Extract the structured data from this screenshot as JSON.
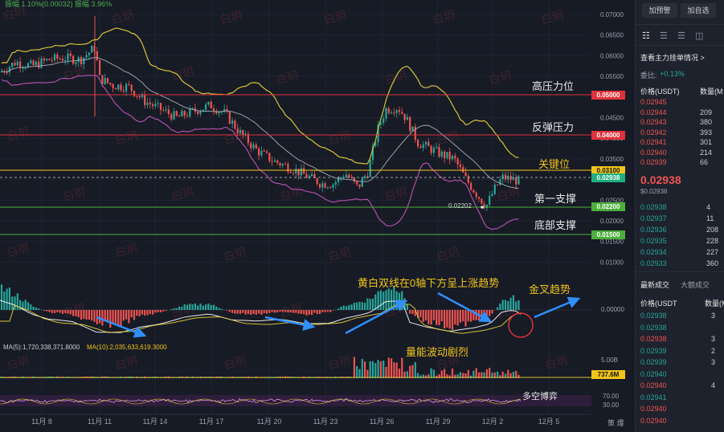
{
  "header": {
    "label": "振幅 1.10%(0.00032) 振幅 3.96%"
  },
  "watermark": "白玥",
  "price_axis": [
    "0.07000",
    "0.06500",
    "0.06000",
    "0.05500",
    "0.05000",
    "0.04500",
    "0.04000",
    "0.03500",
    "0.03000",
    "0.02500",
    "0.02000",
    "0.01500",
    "0.01000"
  ],
  "level_tags": [
    {
      "text": "0.05000",
      "color": "#e0323c"
    },
    {
      "text": "0.04000",
      "color": "#e0323c"
    },
    {
      "text": "0.03100",
      "color": "#f0c419"
    },
    {
      "text": "0.02938",
      "color": "#1fae7e"
    },
    {
      "text": "0.02200",
      "color": "#4caf3a"
    },
    {
      "text": "0.01500",
      "color": "#4caf3a"
    }
  ],
  "level_labels": {
    "high": "高压力位",
    "rebound": "反弹压力",
    "key": "关键位",
    "support1": "第一支撑",
    "support2": "底部支撑"
  },
  "low_marker": "0.02202",
  "macd": {
    "zero": "0.00000",
    "annotation1": "黄白双线在0轴下方呈上涨趋势",
    "annotation2": "金叉趋势"
  },
  "volume": {
    "ma5": "MA(5):1,720,338,371.8000",
    "ma10": "MA(10):2,035,633,619.3000",
    "axis_top": "5.00B",
    "last": "737.6M",
    "annotation": "量能波动剧烈"
  },
  "rsi": {
    "annotation": "多空博弈",
    "axis": [
      "70.00",
      "30.00"
    ]
  },
  "date_axis": [
    "11月 8",
    "11月 11",
    "11月 14",
    "11月 17",
    "11月 20",
    "11月 23",
    "11月 26",
    "11月 29",
    "12月 2",
    "12月 5"
  ],
  "corner_text": "策 爆",
  "colors": {
    "up": "#26a69a",
    "down": "#ef5350",
    "accent": "#f0c419",
    "bg": "#171b26"
  },
  "panel": {
    "buttons": [
      "加预警",
      "加自选"
    ],
    "toolbar_icons": [
      "layout-icon",
      "list-icon",
      "list-alt-icon",
      "split-icon"
    ],
    "link": "查看主力挂单情况 >",
    "change_label": "委比:",
    "change_value": "+0.13%",
    "col_price": "价格(USDT)",
    "col_qty": "数量(M",
    "asks": [
      {
        "p": "0.02945",
        "q": ""
      },
      {
        "p": "0.02944",
        "q": "209"
      },
      {
        "p": "0.02943",
        "q": "380"
      },
      {
        "p": "0.02942",
        "q": "393"
      },
      {
        "p": "0.02941",
        "q": "301"
      },
      {
        "p": "0.02940",
        "q": "214"
      },
      {
        "p": "0.02939",
        "q": "66"
      }
    ],
    "last_price": "0.02938",
    "last_sub": "$0.02938",
    "bids": [
      {
        "p": "0.02938",
        "q": "4"
      },
      {
        "p": "0.02937",
        "q": "11"
      },
      {
        "p": "0.02936",
        "q": "208"
      },
      {
        "p": "0.02935",
        "q": "228"
      },
      {
        "p": "0.02934",
        "q": "227"
      },
      {
        "p": "0.02933",
        "q": "360"
      }
    ],
    "trades_tab": "最新成交",
    "large_tab": "大额成交",
    "trade_col_price": "价格(USDT",
    "trade_col_qty": "数量(M",
    "trades": [
      {
        "p": "0.02938",
        "q": "3",
        "side": "buy"
      },
      {
        "p": "0.02938",
        "q": "",
        "side": "buy"
      },
      {
        "p": "0.02938",
        "q": "3",
        "side": "sell"
      },
      {
        "p": "0.02939",
        "q": "2",
        "side": "buy"
      },
      {
        "p": "0.02939",
        "q": "3",
        "side": "buy"
      },
      {
        "p": "0.02940",
        "q": "",
        "side": "buy"
      },
      {
        "p": "0.02940",
        "q": "4",
        "side": "sell"
      },
      {
        "p": "0.02941",
        "q": "",
        "side": "buy"
      },
      {
        "p": "0.02940",
        "q": "",
        "side": "sell"
      },
      {
        "p": "0.02940",
        "q": "",
        "side": "sell"
      }
    ]
  }
}
